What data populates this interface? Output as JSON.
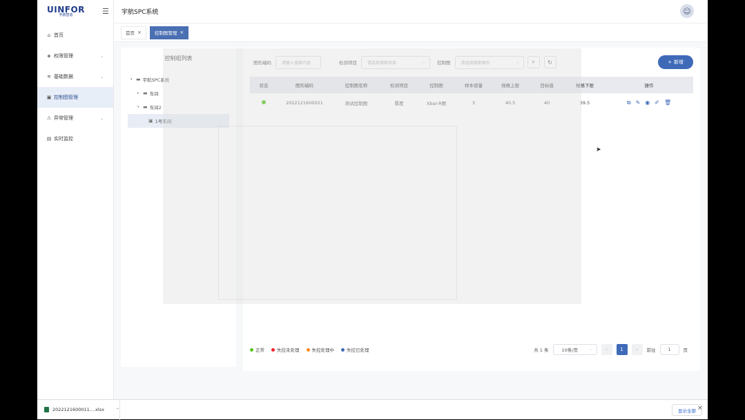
{
  "logo": {
    "text": "UINFOR",
    "sub": "宇航智造"
  },
  "header": {
    "title": "宇航SPC系统"
  },
  "sidebar": {
    "items": [
      {
        "label": "首页",
        "icon": "home-icon",
        "glyph": "⌂",
        "chev": ""
      },
      {
        "label": "权限管理",
        "icon": "shield-icon",
        "glyph": "◈",
        "chev": "⌄"
      },
      {
        "label": "基础数据",
        "icon": "layers-icon",
        "glyph": "≋",
        "chev": "⌄"
      },
      {
        "label": "控制图管理",
        "icon": "monitor-icon",
        "glyph": "▣",
        "chev": ""
      },
      {
        "label": "异常管理",
        "icon": "alert-icon",
        "glyph": "⚠",
        "chev": "⌄"
      },
      {
        "label": "实时监控",
        "icon": "file-icon",
        "glyph": "▤",
        "chev": ""
      }
    ]
  },
  "tabs": [
    {
      "label": "首页",
      "close": "×"
    },
    {
      "label": "控制图管理",
      "close": "×"
    }
  ],
  "tree": {
    "title": "控制组列表",
    "nodes": [
      "宇航SPC系统",
      "车间",
      "车间2",
      "1号车间"
    ]
  },
  "filter": {
    "code_label": "图形编码",
    "code_placeholder": "请输入搜索内容",
    "item_label": "检测项目",
    "item_placeholder": "请选择搜索项目",
    "chart_label": "控制图",
    "chart_placeholder": "请选择搜索图形"
  },
  "add_button": {
    "plus": "+",
    "label": "新增"
  },
  "table": {
    "headers": [
      "状态",
      "图形编码",
      "控制图名称",
      "检测项目",
      "控制图",
      "样本容量",
      "规格上限",
      "目标值",
      "规格下限",
      "操作"
    ],
    "rows": [
      {
        "status_color": "#52c41a",
        "code": "2022121600021",
        "name": "测试控制图",
        "item": "厚度",
        "chart": "Xbar-R图",
        "sample": "3",
        "usl": "40.5",
        "target": "40",
        "lsl": "39.5"
      }
    ]
  },
  "legend": [
    {
      "label": "正常",
      "color": "#52c41a"
    },
    {
      "label": "失控未处理",
      "color": "#f5222d"
    },
    {
      "label": "失控处理中",
      "color": "#fa8c16"
    },
    {
      "label": "失控已处理",
      "color": "#3f6ab8"
    }
  ],
  "pagination": {
    "total": "共 1 条",
    "size": "10条/页",
    "current": "1",
    "goto_label": "前往",
    "goto_value": "1",
    "page_suffix": "页"
  },
  "downloads": {
    "file": "2022121600011....xlsx",
    "show_all": "显示全部",
    "close": "×"
  }
}
